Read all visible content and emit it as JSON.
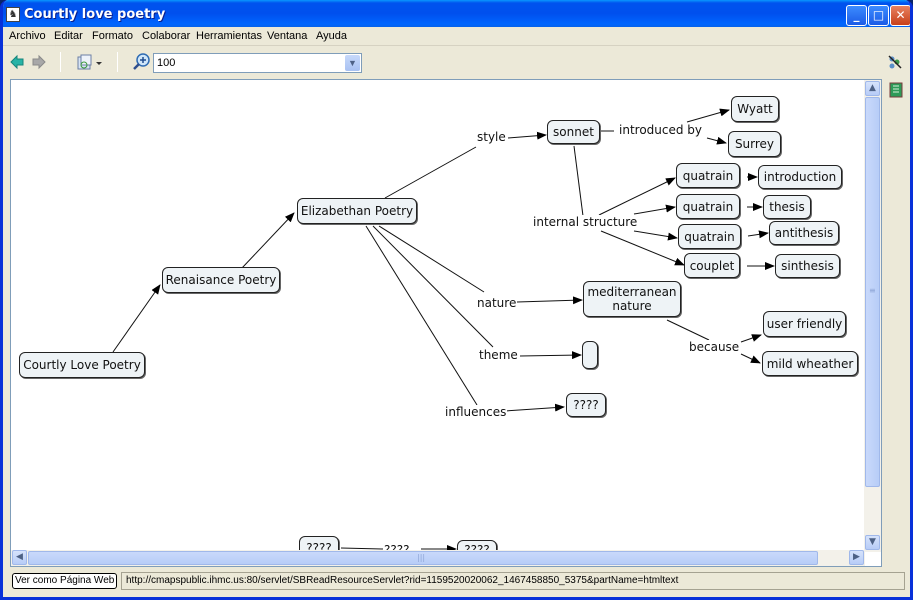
{
  "window": {
    "title": "Courtly love poetry",
    "buttons": {
      "minimize": "_",
      "maximize": "□",
      "close": "✕"
    }
  },
  "menubar": {
    "items": [
      "Archivo",
      "Editar",
      "Formato",
      "Colaborar",
      "Herramientas",
      "Ventana",
      "Ayuda"
    ]
  },
  "toolbar": {
    "back_icon": "arrow-left-icon",
    "forward_icon": "arrow-right-icon",
    "view_icon": "presentation-icon",
    "zoom_icon": "zoom-in-icon",
    "zoom_value": "100",
    "side_icons": [
      "collaboration-disabled-icon",
      "notes-icon"
    ]
  },
  "concept_map": {
    "concepts": [
      {
        "id": "courtly",
        "label": "Courtly Love Poetry"
      },
      {
        "id": "renaissance",
        "label": "Renaisance Poetry"
      },
      {
        "id": "elizabethan",
        "label": "Elizabethan Poetry"
      },
      {
        "id": "sonnet",
        "label": "sonnet"
      },
      {
        "id": "wyatt",
        "label": "Wyatt"
      },
      {
        "id": "surrey",
        "label": "Surrey"
      },
      {
        "id": "quatrain1",
        "label": "quatrain"
      },
      {
        "id": "quatrain2",
        "label": "quatrain"
      },
      {
        "id": "quatrain3",
        "label": "quatrain"
      },
      {
        "id": "couplet",
        "label": "couplet"
      },
      {
        "id": "introduction",
        "label": "introduction"
      },
      {
        "id": "thesis",
        "label": "thesis"
      },
      {
        "id": "antithesis",
        "label": "antithesis"
      },
      {
        "id": "sinthesis",
        "label": "sinthesis"
      },
      {
        "id": "mediterranean",
        "label": "mediterranean nature"
      },
      {
        "id": "userfriendly",
        "label": "user friendly"
      },
      {
        "id": "mildweather",
        "label": "mild wheather"
      },
      {
        "id": "theme_empty",
        "label": ""
      },
      {
        "id": "influences_q",
        "label": "????"
      },
      {
        "id": "bottom_q1",
        "label": "????"
      },
      {
        "id": "bottom_q2",
        "label": "????"
      }
    ],
    "linking_phrases": [
      {
        "id": "style",
        "label": "style"
      },
      {
        "id": "introduced_by",
        "label": "introduced by"
      },
      {
        "id": "internal_structure",
        "label": "internal structure"
      },
      {
        "id": "nature",
        "label": "nature"
      },
      {
        "id": "theme",
        "label": "theme"
      },
      {
        "id": "influences",
        "label": "influences"
      },
      {
        "id": "because",
        "label": "because"
      },
      {
        "id": "bottom_link",
        "label": "????"
      }
    ]
  },
  "statusbar": {
    "web_button": "Ver como Página Web",
    "url": "http://cmapspublic.ihmc.us:80/servlet/SBReadResourceServlet?rid=1159520020062_1467458850_5375&partName=htmltext"
  },
  "colors": {
    "node_fill": "#eef3f6",
    "node_border": "#222222",
    "titlebar": "#0053ee",
    "chrome": "#ece9d8"
  }
}
